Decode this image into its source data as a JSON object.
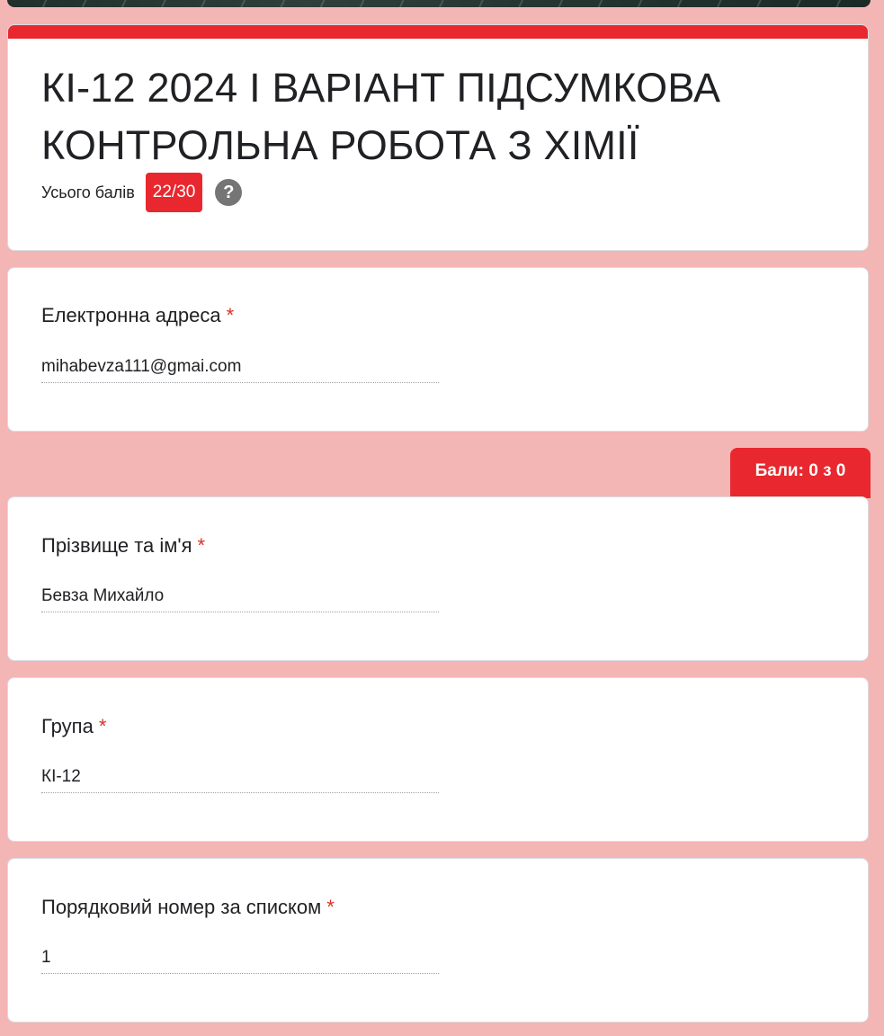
{
  "header": {
    "title": "КІ-12 2024 І ВАРІАНТ ПІДСУМКОВА КОНТРОЛЬНА РОБОТА З ХІМІЇ",
    "total_score_label": "Усього балів",
    "total_score_value": "22/30",
    "help_symbol": "?",
    "help_icon": "help-circle-icon"
  },
  "questions": {
    "email": {
      "label": "Електронна адреса",
      "required_mark": "*",
      "value": "mihabevza111@gmai.com"
    },
    "section_score": "Бали: 0 з 0",
    "name": {
      "label": "Прізвище та ім'я",
      "required_mark": "*",
      "value": "Бевза Михайло"
    },
    "group": {
      "label": "Група",
      "required_mark": "*",
      "value": "КІ-12"
    },
    "number": {
      "label": "Порядковий номер за списком",
      "required_mark": "*",
      "value": "1"
    }
  },
  "colors": {
    "accent": "#e8282e",
    "page_background": "#f4b5b5",
    "required": "#d93025"
  }
}
